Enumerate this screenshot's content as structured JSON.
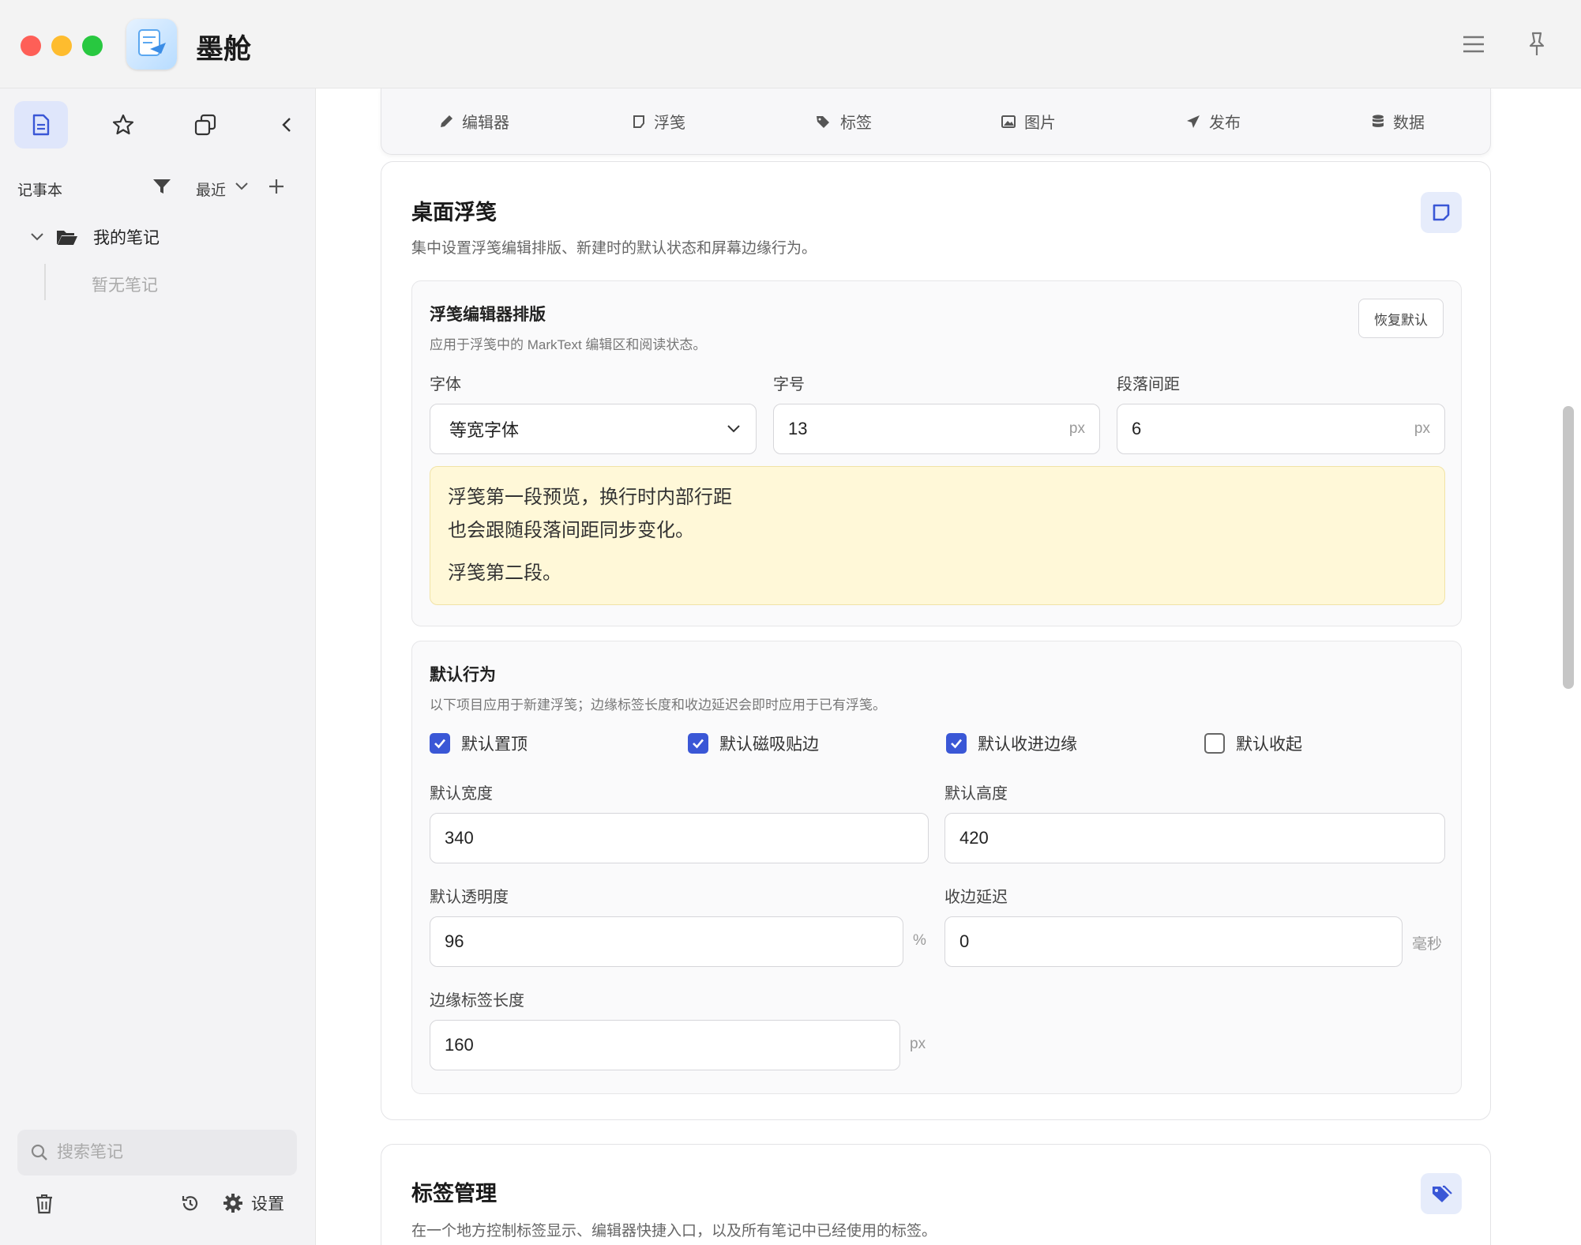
{
  "app": {
    "name": "墨舱"
  },
  "sidebar": {
    "notebook_label": "记事本",
    "sort_label": "最近",
    "tree": {
      "folder_label": "我的笔记",
      "empty_label": "暂无笔记"
    },
    "search_placeholder": "搜索笔记",
    "settings_label": "设置"
  },
  "tabs": [
    {
      "label": "编辑器",
      "icon": "pencil-icon"
    },
    {
      "label": "浮笺",
      "icon": "sticky-note-icon"
    },
    {
      "label": "标签",
      "icon": "tags-icon"
    },
    {
      "label": "图片",
      "icon": "image-icon"
    },
    {
      "label": "发布",
      "icon": "send-icon"
    },
    {
      "label": "数据",
      "icon": "database-icon"
    }
  ],
  "desktop_notes": {
    "title": "桌面浮笺",
    "description": "集中设置浮笺编辑排版、新建时的默认状态和屏幕边缘行为。",
    "layout": {
      "title": "浮笺编辑器排版",
      "description": "应用于浮笺中的 MarkText 编辑区和阅读状态。",
      "reset_label": "恢复默认",
      "font_label": "字体",
      "font_value": "等宽字体",
      "size_label": "字号",
      "size_value": "13",
      "spacing_label": "段落间距",
      "spacing_value": "6",
      "unit_px": "px",
      "preview_line1": "浮笺第一段预览，换行时内部行距",
      "preview_line2": "也会跟随段落间距同步变化。",
      "preview_line3": "浮笺第二段。"
    },
    "behavior": {
      "title": "默认行为",
      "description": "以下项目应用于新建浮笺；边缘标签长度和收边延迟会即时应用于已有浮笺。",
      "checks": [
        {
          "label": "默认置顶",
          "checked": true
        },
        {
          "label": "默认磁吸贴边",
          "checked": true
        },
        {
          "label": "默认收进边缘",
          "checked": true
        },
        {
          "label": "默认收起",
          "checked": false
        }
      ],
      "width_label": "默认宽度",
      "width_value": "340",
      "height_label": "默认高度",
      "height_value": "420",
      "opacity_label": "默认透明度",
      "opacity_value": "96",
      "opacity_unit": "%",
      "delay_label": "收边延迟",
      "delay_value": "0",
      "delay_unit": "毫秒",
      "tab_length_label": "边缘标签长度",
      "tab_length_value": "160",
      "tab_length_unit": "px"
    }
  },
  "tag_management": {
    "title": "标签管理",
    "description": "在一个地方控制标签显示、编辑器快捷入口，以及所有笔记中已经使用的标签。"
  },
  "colors": {
    "accent": "#3a57d6",
    "preview_bg": "#fff8d8",
    "sidebar_bg": "#f3f3f5"
  }
}
